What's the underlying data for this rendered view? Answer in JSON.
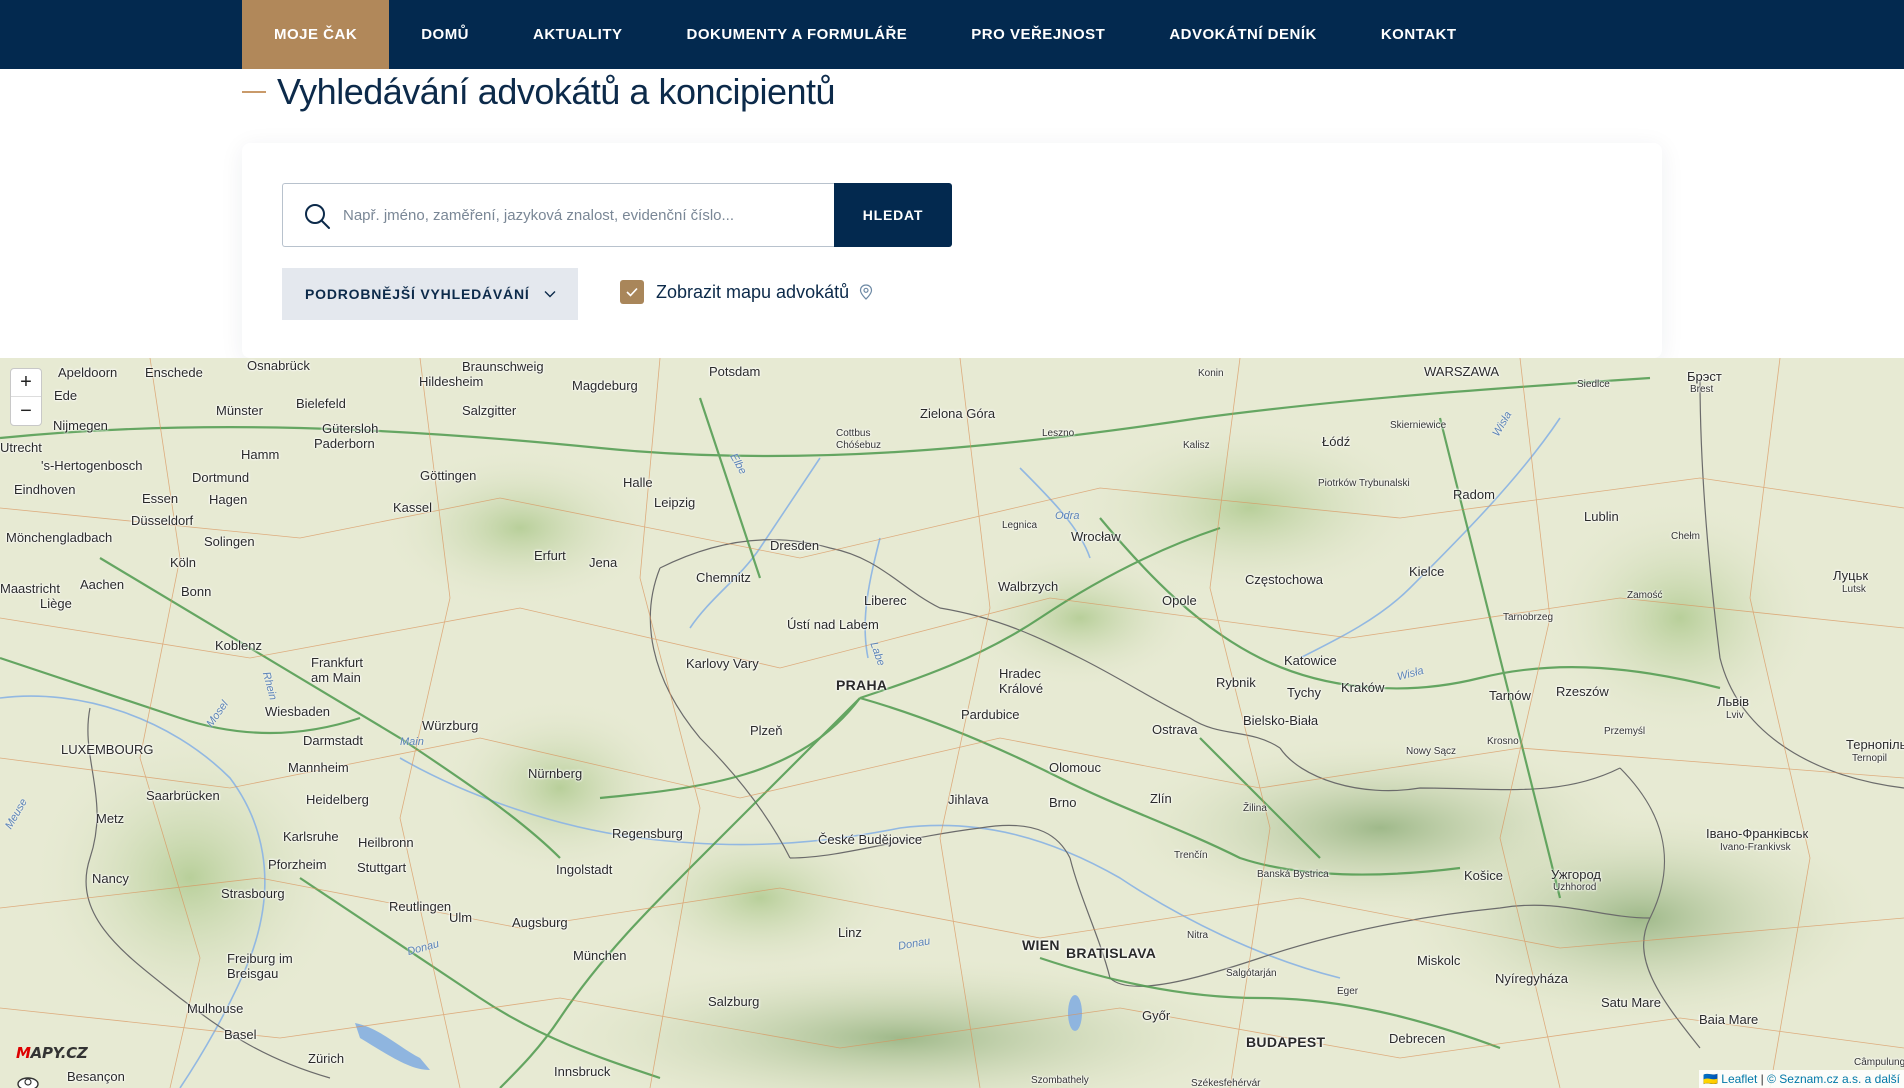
{
  "nav": {
    "items": [
      {
        "label": "MOJE ČAK",
        "active": true
      },
      {
        "label": "DOMŮ"
      },
      {
        "label": "AKTUALITY"
      },
      {
        "label": "DOKUMENTY A FORMULÁŘE"
      },
      {
        "label": "PRO VEŘEJNOST"
      },
      {
        "label": "ADVOKÁTNÍ DENÍK"
      },
      {
        "label": "KONTAKT"
      }
    ]
  },
  "page": {
    "title": "Vyhledávání advokátů a koncipientů"
  },
  "search": {
    "placeholder": "Např. jméno, zaměření, jazyková znalost, evidenční číslo...",
    "value": "",
    "button_label": "HLEDAT",
    "advanced_label": "PODROBNĚJŠÍ VYHLEDÁVÁNÍ",
    "show_map_label": "Zobrazit mapu advokátů",
    "show_map_checked": true
  },
  "map": {
    "zoom_in": "+",
    "zoom_out": "−",
    "logo_m": "M",
    "logo_rest": "APY.CZ",
    "attribution_leaflet": "Leaflet",
    "attribution_sep": " | ",
    "attribution_seznam": "© Seznam.cz a.s. a další",
    "cities": [
      {
        "name": "Osnabrück"
      },
      {
        "name": "Apeldoorn"
      },
      {
        "name": "Enschede"
      },
      {
        "name": "Ede"
      },
      {
        "name": "Braunschweig"
      },
      {
        "name": "Hildesheim"
      },
      {
        "name": "Magdeburg"
      },
      {
        "name": "Potsdam"
      },
      {
        "name": "Konin"
      },
      {
        "name": "WARSZAWA"
      },
      {
        "name": "Brest"
      },
      {
        "name": "Брэст"
      },
      {
        "name": "Bielefeld"
      },
      {
        "name": "Salzgitter"
      },
      {
        "name": "Münster"
      },
      {
        "name": "Gütersloh"
      },
      {
        "name": "Paderborn"
      },
      {
        "name": "Nijmegen"
      },
      {
        "name": "Zielona Góra"
      },
      {
        "name": "Cottbus"
      },
      {
        "name": "Chóśebuz"
      },
      {
        "name": "Leszno"
      },
      {
        "name": "Siedlce"
      },
      {
        "name": "Łódź"
      },
      {
        "name": "Skierniewice"
      },
      {
        "name": "Kalisz"
      },
      {
        "name": "Hamm"
      },
      {
        "name": "Dortmund"
      },
      {
        "name": "'s-Hertogenbosch"
      },
      {
        "name": "Göttingen"
      },
      {
        "name": "Halle"
      },
      {
        "name": "Piotrków Trybunalski"
      },
      {
        "name": "Radom"
      },
      {
        "name": "Eindhoven"
      },
      {
        "name": "Essen"
      },
      {
        "name": "Hagen"
      },
      {
        "name": "Kassel"
      },
      {
        "name": "Leipzig"
      },
      {
        "name": "Düsseldorf"
      },
      {
        "name": "Legnica"
      },
      {
        "name": "Lublin"
      },
      {
        "name": "Mönchengladbach"
      },
      {
        "name": "Solingen"
      },
      {
        "name": "Dresden"
      },
      {
        "name": "Wrocław"
      },
      {
        "name": "Chełm"
      },
      {
        "name": "Erfurt"
      },
      {
        "name": "Jena"
      },
      {
        "name": "Köln"
      },
      {
        "name": "Chemnitz"
      },
      {
        "name": "Częstochowa"
      },
      {
        "name": "Kielce"
      },
      {
        "name": "Maastricht"
      },
      {
        "name": "Aachen"
      },
      {
        "name": "Walbrzych"
      },
      {
        "name": "Луцьк"
      },
      {
        "name": "Lutsk"
      },
      {
        "name": "Bonn"
      },
      {
        "name": "Liberec"
      },
      {
        "name": "Opole"
      },
      {
        "name": "Zamość"
      },
      {
        "name": "Liège"
      },
      {
        "name": "Tarnobrzeg"
      },
      {
        "name": "Ústí nad Labem"
      },
      {
        "name": "Koblenz"
      },
      {
        "name": "Katowice"
      },
      {
        "name": "Frankfurt am Main"
      },
      {
        "name": "Karlovy Vary"
      },
      {
        "name": "Hradec Králové"
      },
      {
        "name": "Rybnik"
      },
      {
        "name": "Tychy"
      },
      {
        "name": "Kraków"
      },
      {
        "name": "Tarnów"
      },
      {
        "name": "Rzeszów"
      },
      {
        "name": "PRAHA"
      },
      {
        "name": "Львів"
      },
      {
        "name": "Lviv"
      },
      {
        "name": "Wiesbaden"
      },
      {
        "name": "Pardubice"
      },
      {
        "name": "Bielsko-Biała"
      },
      {
        "name": "Darmstadt"
      },
      {
        "name": "Würzburg"
      },
      {
        "name": "Plzeň"
      },
      {
        "name": "Ostrava"
      },
      {
        "name": "Przemyśl"
      },
      {
        "name": "Krosno"
      },
      {
        "name": "Тернопіль"
      },
      {
        "name": "Ternopil"
      },
      {
        "name": "LUXEMBOURG"
      },
      {
        "name": "Nowy Sącz"
      },
      {
        "name": "Olomouc"
      },
      {
        "name": "Mannheim"
      },
      {
        "name": "Nürnberg"
      },
      {
        "name": "Saarbrücken"
      },
      {
        "name": "Heidelberg"
      },
      {
        "name": "Jihlava"
      },
      {
        "name": "Zlín"
      },
      {
        "name": "Brno"
      },
      {
        "name": "Žilina"
      },
      {
        "name": "Metz"
      },
      {
        "name": "Karlsruhe"
      },
      {
        "name": "Regensburg"
      },
      {
        "name": "Heilbronn"
      },
      {
        "name": "České Budějovice"
      },
      {
        "name": "Івано-Франківськ"
      },
      {
        "name": "Ivano-Frankivsk"
      },
      {
        "name": "Trenčín"
      },
      {
        "name": "Pforzheim"
      },
      {
        "name": "Stuttgart"
      },
      {
        "name": "Ingolstadt"
      },
      {
        "name": "Nancy"
      },
      {
        "name": "Banská Bystrica"
      },
      {
        "name": "Košice"
      },
      {
        "name": "Ужгород"
      },
      {
        "name": "Uzhhorod"
      },
      {
        "name": "Strasbourg"
      },
      {
        "name": "Reutlingen"
      },
      {
        "name": "Ulm"
      },
      {
        "name": "Augsburg"
      },
      {
        "name": "Nitra"
      },
      {
        "name": "Linz"
      },
      {
        "name": "WIEN"
      },
      {
        "name": "BRATISLAVA"
      },
      {
        "name": "München"
      },
      {
        "name": "Miskolc"
      },
      {
        "name": "Freiburg im Breisgau"
      },
      {
        "name": "Salgótarján"
      },
      {
        "name": "Eger"
      },
      {
        "name": "Nyíregyháza"
      },
      {
        "name": "Salzburg"
      },
      {
        "name": "Győr"
      },
      {
        "name": "Satu Mare"
      },
      {
        "name": "Mulhouse"
      },
      {
        "name": "Baia Mare"
      },
      {
        "name": "Basel"
      },
      {
        "name": "BUDAPEST"
      },
      {
        "name": "Debrecen"
      },
      {
        "name": "Zürich"
      },
      {
        "name": "Innsbruck"
      },
      {
        "name": "Besançon"
      },
      {
        "name": "Szombathely"
      },
      {
        "name": "Székesfehérvár"
      },
      {
        "name": "Câmpulung"
      },
      {
        "name": "Utrecht"
      }
    ],
    "rivers": [
      {
        "name": "Elbe"
      },
      {
        "name": "Odra"
      },
      {
        "name": "Wisła"
      },
      {
        "name": "Labe"
      },
      {
        "name": "Rhein"
      },
      {
        "name": "Mosel"
      },
      {
        "name": "Main"
      },
      {
        "name": "Donau"
      },
      {
        "name": "Donau"
      },
      {
        "name": "Meuse"
      },
      {
        "name": "Wisła"
      }
    ]
  }
}
